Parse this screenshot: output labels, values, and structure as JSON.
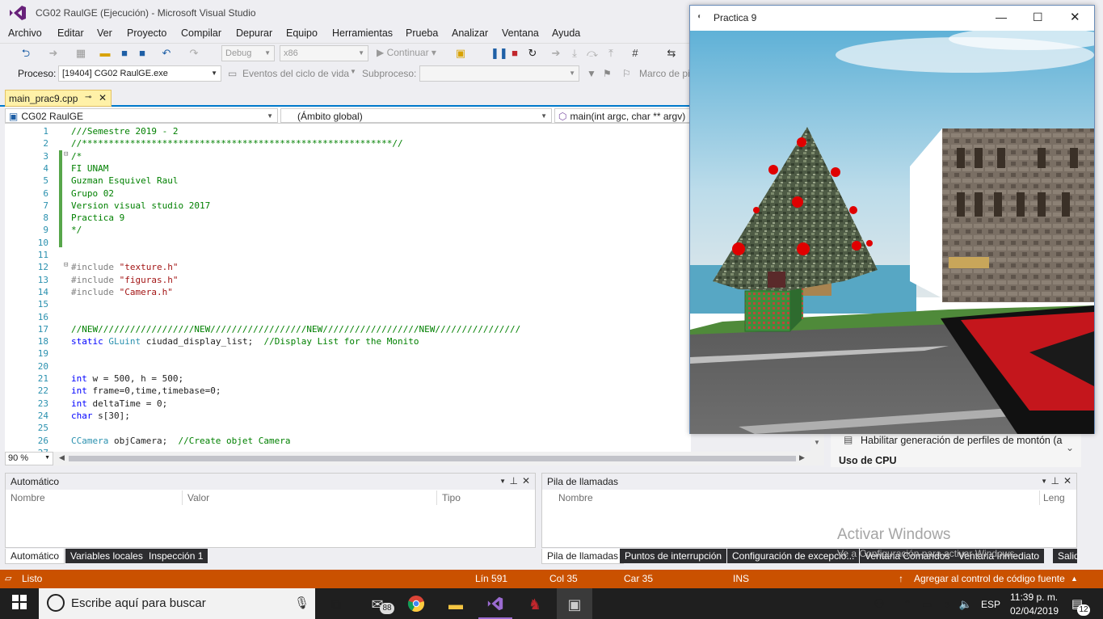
{
  "app": {
    "title": "CG02 RaulGE (Ejecución) - Microsoft Visual Studio"
  },
  "menu": [
    "Archivo",
    "Editar",
    "Ver",
    "Proyecto",
    "Compilar",
    "Depurar",
    "Equipo",
    "Herramientas",
    "Prueba",
    "Analizar",
    "Ventana",
    "Ayuda"
  ],
  "toolbar": {
    "config": "Debug",
    "platform": "x86",
    "continue": "Continuar"
  },
  "toolbar2": {
    "process_label": "Proceso:",
    "process_value": "[19404] CG02 RaulGE.exe",
    "events": "Eventos del ciclo de vida",
    "thread_label": "Subproceso:",
    "stack": "Marco de pi"
  },
  "editor": {
    "tab": "main_prac9.cpp",
    "project": "CG02 RaulGE",
    "scope": "(Ámbito global)",
    "function": "main(int argc, char ** argv)",
    "zoom": "90 %",
    "lines": [
      {
        "n": "1",
        "t": "///Semestre 2019 - 2",
        "c": "cm"
      },
      {
        "n": "2",
        "t": "//**********************************************************//",
        "c": "cm"
      },
      {
        "n": "3",
        "t": "/*",
        "c": "cm"
      },
      {
        "n": "4",
        "t": "FI UNAM",
        "c": "cm"
      },
      {
        "n": "5",
        "t": "Guzman Esquivel Raul",
        "c": "cm"
      },
      {
        "n": "6",
        "t": "Grupo 02",
        "c": "cm"
      },
      {
        "n": "7",
        "t": "Version visual studio 2017",
        "c": "cm"
      },
      {
        "n": "8",
        "t": "Practica 9",
        "c": "cm"
      },
      {
        "n": "9",
        "t": "*/",
        "c": "cm"
      },
      {
        "n": "10",
        "t": "",
        "c": ""
      },
      {
        "n": "11",
        "t": "",
        "c": ""
      },
      {
        "n": "12",
        "t": "#include \"texture.h\"",
        "c": "inc"
      },
      {
        "n": "13",
        "t": "#include \"figuras.h\"",
        "c": "inc"
      },
      {
        "n": "14",
        "t": "#include \"Camera.h\"",
        "c": "inc"
      },
      {
        "n": "15",
        "t": "",
        "c": ""
      },
      {
        "n": "16",
        "t": "",
        "c": ""
      },
      {
        "n": "17",
        "t": "//NEW//////////////////NEW//////////////////NEW//////////////////NEW////////////////",
        "c": "cm"
      },
      {
        "n": "18",
        "t": "static GLuint ciudad_display_list;  //Display List for the Monito",
        "c": "decl"
      },
      {
        "n": "19",
        "t": "",
        "c": ""
      },
      {
        "n": "20",
        "t": "",
        "c": ""
      },
      {
        "n": "21",
        "t": "int w = 500, h = 500;",
        "c": "int"
      },
      {
        "n": "22",
        "t": "int frame=0,time,timebase=0;",
        "c": "int"
      },
      {
        "n": "23",
        "t": "int deltaTime = 0;",
        "c": "int"
      },
      {
        "n": "24",
        "t": "char s[30];",
        "c": "char"
      },
      {
        "n": "25",
        "t": "",
        "c": ""
      },
      {
        "n": "26",
        "t": "CCamera objCamera;  //Create objet Camera",
        "c": "cam"
      },
      {
        "n": "27",
        "t": "",
        "c": ""
      }
    ]
  },
  "diagnostics": {
    "heap": "Habilitar generación de perfiles de montón (a",
    "cpu": "Uso de CPU"
  },
  "autos": {
    "title": "Automático",
    "cols": [
      "Nombre",
      "Valor",
      "Tipo"
    ],
    "tabs": [
      "Automático",
      "Variables locales",
      "Inspección 1"
    ]
  },
  "callstack": {
    "title": "Pila de llamadas",
    "cols": [
      "Nombre",
      "Leng"
    ],
    "tabs": [
      "Pila de llamadas",
      "Puntos de interrupción",
      "Configuración de excepcio...",
      "Ventana Comandos",
      "Ventana Inmediato",
      "Salida"
    ]
  },
  "watermark": {
    "line1": "Activar Windows",
    "line2": "Ve a Configuración para activar Windows."
  },
  "status": {
    "ready": "Listo",
    "line": "Lín 591",
    "col": "Col 35",
    "car": "Car 35",
    "ins": "INS",
    "source": "Agregar al control de código fuente"
  },
  "glut": {
    "title": "Practica 9"
  },
  "taskbar": {
    "search": "Escribe aquí para buscar",
    "mail_badge": "88",
    "lang": "ESP",
    "time": "11:39 p. m.",
    "date": "02/04/2019",
    "notif": "12"
  }
}
